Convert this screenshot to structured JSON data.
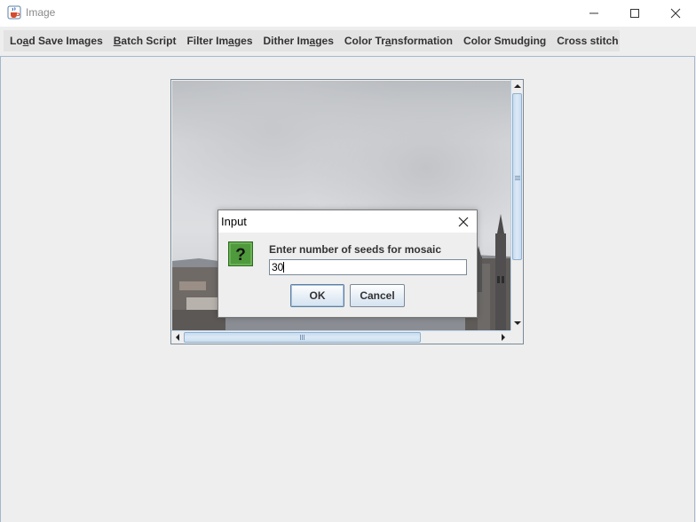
{
  "window": {
    "title": "Image",
    "icon": "java-cup-icon",
    "controls": [
      "minimize-icon",
      "maximize-icon",
      "close-icon"
    ]
  },
  "menubar": {
    "items": [
      {
        "pre": "Lo",
        "mnemonic": "a",
        "post": "d Save Images"
      },
      {
        "pre": "",
        "mnemonic": "B",
        "post": "atch Script"
      },
      {
        "pre": "Filter Im",
        "mnemonic": "a",
        "post": "ges"
      },
      {
        "pre": "Dither Im",
        "mnemonic": "a",
        "post": "ges"
      },
      {
        "pre": "Color Tr",
        "mnemonic": "a",
        "post": "nsformation"
      },
      {
        "pre": "Color Smudging",
        "mnemonic": "",
        "post": ""
      },
      {
        "pre": "Cross stitch",
        "mnemonic": "",
        "post": ""
      }
    ]
  },
  "image_panel": {
    "content": "city skyline photo under overcast sky",
    "vertical_scroll": {
      "thumb_fraction_start": 0.0,
      "thumb_fraction_size": 0.7
    },
    "horizontal_scroll": {
      "thumb_fraction_start": 0.0,
      "thumb_fraction_size": 0.76
    }
  },
  "dialog": {
    "title": "Input",
    "icon": "question-icon",
    "prompt": "Enter number of seeds for mosaic",
    "input_value": "30",
    "ok_label": "OK",
    "cancel_label": "Cancel"
  },
  "colors": {
    "frame_bg": "#eeeeee",
    "menubar_bg": "#e3e3e3",
    "accent_border": "#a3b8cc",
    "question_icon_green": "#4f9a3c"
  }
}
